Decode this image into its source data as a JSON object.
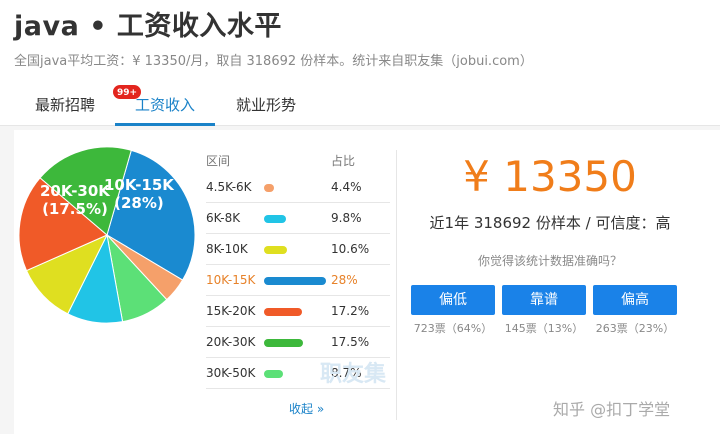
{
  "header": {
    "title": "java • 工资收入水平",
    "subtitle": "全国java平均工资：¥ 13350/月，取自 318692 份样本。统计来自职友集（jobui.com）"
  },
  "tabs": [
    {
      "label": "最新招聘",
      "badge": "99+"
    },
    {
      "label": "工资收入"
    },
    {
      "label": "就业形势"
    }
  ],
  "pie_labels": {
    "a": "10K-15K",
    "a_pct": "(28%)",
    "b": "20K-30K",
    "b_pct": "(17.5%)"
  },
  "table": {
    "col_range": "区间",
    "col_share": "占比",
    "collapse_label": "收起 »",
    "watermark": "职友集"
  },
  "chart_data": {
    "type": "pie",
    "categories": [
      "4.5K-6K",
      "6K-8K",
      "8K-10K",
      "10K-15K",
      "15K-20K",
      "20K-30K",
      "30K-50K"
    ],
    "values": [
      4.4,
      9.8,
      10.6,
      28,
      17.2,
      17.5,
      8.7
    ],
    "labels": [
      "4.4%",
      "9.8%",
      "10.6%",
      "28%",
      "17.2%",
      "17.5%",
      "8.7%"
    ],
    "colors": [
      "#f5a06a",
      "#21c4e6",
      "#dfdf20",
      "#1a8ad0",
      "#f05a28",
      "#3db83b",
      "#5ce077"
    ],
    "highlight": "10K-15K"
  },
  "summary": {
    "salary": "¥ 13350",
    "sample": "近1年 318692 份样本 / 可信度：高",
    "question": "你觉得该统计数据准确吗？"
  },
  "votes": [
    {
      "label": "偏低",
      "count": "723票（64%）"
    },
    {
      "label": "靠谱",
      "count": "145票（13%）"
    },
    {
      "label": "偏高",
      "count": "263票（23%）"
    }
  ],
  "footer": {
    "watermark": "知乎 @扣丁学堂"
  }
}
